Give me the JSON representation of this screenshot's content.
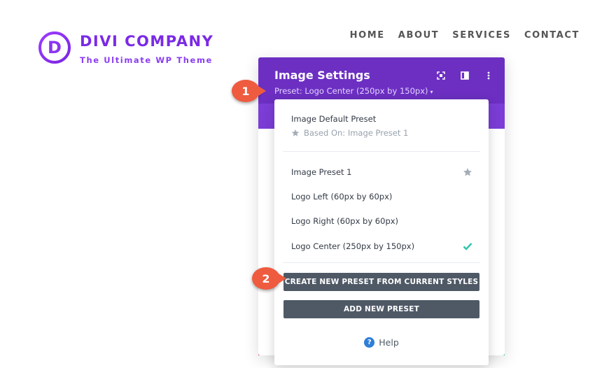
{
  "site": {
    "logo_letter": "D",
    "logo_name": "DIVI COMPANY",
    "tagline": "The Ultimate WP Theme",
    "nav": [
      "HOME",
      "ABOUT",
      "SERVICES",
      "CONTACT"
    ]
  },
  "modal": {
    "title": "Image Settings",
    "preset": "Preset: Logo Center (250px by 150px)",
    "caret": "▾",
    "header_icons": [
      "expand-icon",
      "columns-icon",
      "more-options-icon"
    ]
  },
  "dropdown": {
    "default_title": "Image Default Preset",
    "based_on": "Based On: Image Preset 1",
    "presets": [
      {
        "label": "Image Preset 1",
        "icon": "star-icon"
      },
      {
        "label": "Logo Left (60px by 60px)",
        "icon": ""
      },
      {
        "label": "Logo Right (60px by 60px)",
        "icon": ""
      },
      {
        "label": "Logo Center (250px by 150px)",
        "icon": "check-icon"
      }
    ],
    "create_button": "CREATE NEW PRESET FROM CURRENT STYLES",
    "add_button": "ADD NEW PRESET",
    "help": "Help",
    "help_icon_glyph": "?"
  },
  "badges": [
    "1",
    "2"
  ],
  "colors": {
    "header_purple": "#6c2fc2",
    "logo_purple": "#7a2ae6",
    "button_dark": "#4f5966",
    "check_green": "#2ec4a9",
    "badge_red": "#ef5b3f",
    "help_blue": "#2e7ed8"
  }
}
